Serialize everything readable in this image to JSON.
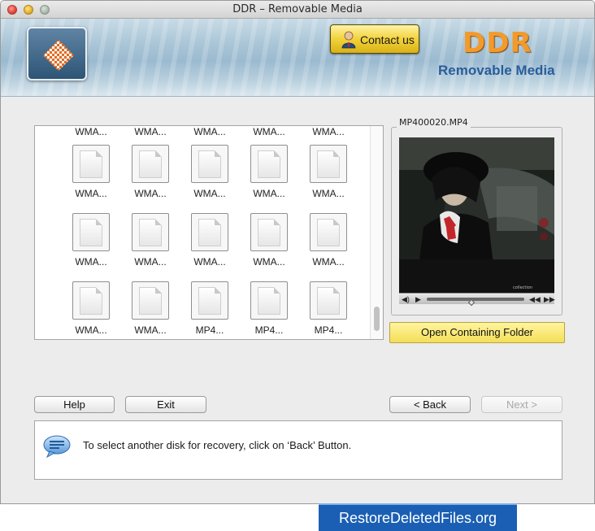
{
  "window": {
    "title": "DDR – Removable Media"
  },
  "header": {
    "contact_label": "Contact us",
    "brand": "DDR",
    "brand_subtitle": "Removable Media",
    "brand_color": "#f39a2a",
    "subtitle_color": "#2a5d9a"
  },
  "files": {
    "rows": [
      [
        "WMA...",
        "WMA...",
        "WMA...",
        "WMA...",
        "WMA..."
      ],
      [
        "WMA...",
        "WMA...",
        "WMA...",
        "WMA...",
        "WMA..."
      ],
      [
        "WMA...",
        "WMA...",
        "WMA...",
        "WMA...",
        "WMA..."
      ],
      [
        "WMA...",
        "WMA...",
        "MP4...",
        "MP4...",
        "MP4..."
      ]
    ]
  },
  "preview": {
    "title": "MP400020.MP4",
    "open_folder_label": "Open Containing Folder"
  },
  "buttons": {
    "help": "Help",
    "exit": "Exit",
    "back": "< Back",
    "next": "Next >"
  },
  "info": {
    "message": "To select another disk for recovery, click on ‘Back’ Button.",
    "icon": "speech-bubble-icon"
  },
  "watermark": "RestoreDeletedFiles.org"
}
